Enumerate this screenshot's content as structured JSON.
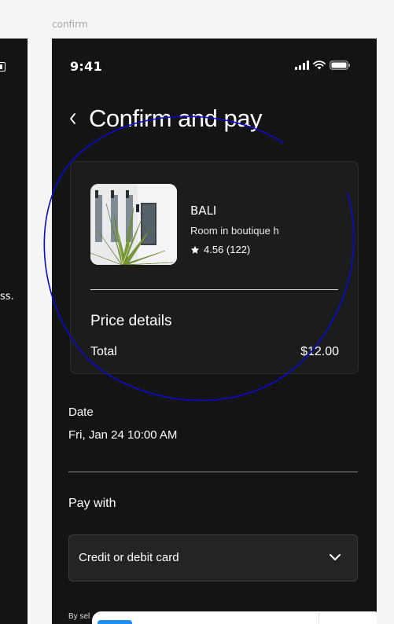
{
  "frame": {
    "label": "confirm"
  },
  "left_phone": {
    "text_fragment": "ss."
  },
  "status_bar": {
    "time": "9:41",
    "icons": [
      "signal-icon",
      "wifi-icon",
      "battery-icon"
    ]
  },
  "header": {
    "back_icon": "chevron-left-icon",
    "title": "Confirm and pay"
  },
  "listing": {
    "location": "BALI",
    "subtitle": "Room in boutique h",
    "rating": "4.56 (122)",
    "star_icon": "star-icon"
  },
  "price_details": {
    "heading": "Price details",
    "total_label": "Total",
    "total_value": "$12.00"
  },
  "date": {
    "label": "Date",
    "value": "Fri, Jan 24 10:00 AM"
  },
  "payment": {
    "label": "Pay with",
    "selected": "Credit or debit card",
    "chevron_icon": "chevron-down-icon"
  },
  "terms": {
    "text": "By sel"
  },
  "colors": {
    "canvas": "#f5f5f5",
    "phone_bg": "#141414",
    "card_bg": "#1c1c1c",
    "annotation_stroke": "#0a0ad0",
    "sheet_accent": "#1d8ff0"
  }
}
